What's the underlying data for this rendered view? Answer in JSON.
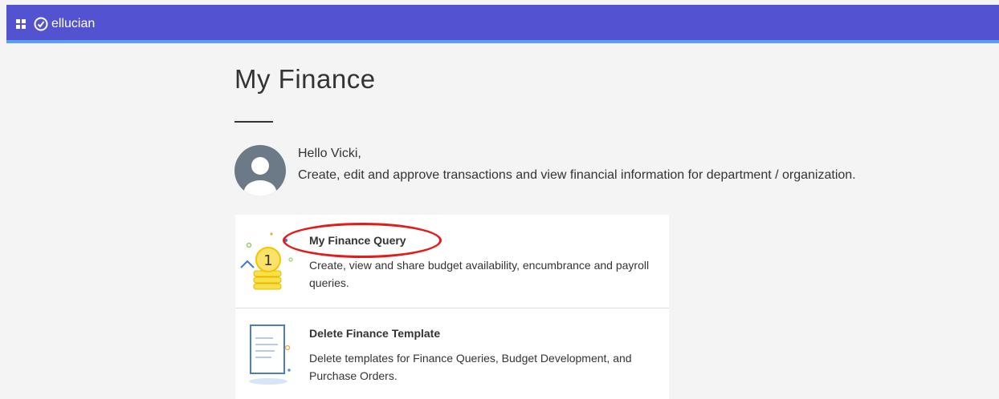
{
  "header": {
    "brand_name": "ellucian",
    "menu_icon": "apps-grid-icon",
    "brand_icon": "ellucian-logo-icon",
    "background_color": "#5353d1",
    "accent_color": "#5a9ef0"
  },
  "main": {
    "title": "My Finance",
    "greeting": "Hello Vicki,",
    "welcome_text": "Create, edit and approve transactions and view financial information for department / organization.",
    "avatar_icon": "user-avatar-icon"
  },
  "cards": [
    {
      "title": "My Finance Query",
      "description": "Create, view and share budget availability, encumbrance and payroll queries.",
      "icon": "coin-stack-icon"
    },
    {
      "title": "Delete Finance Template",
      "description": "Delete templates for Finance Queries, Budget Development, and Purchase Orders.",
      "icon": "document-template-icon"
    }
  ],
  "annotation": {
    "highlight_color": "#e31b1b"
  }
}
